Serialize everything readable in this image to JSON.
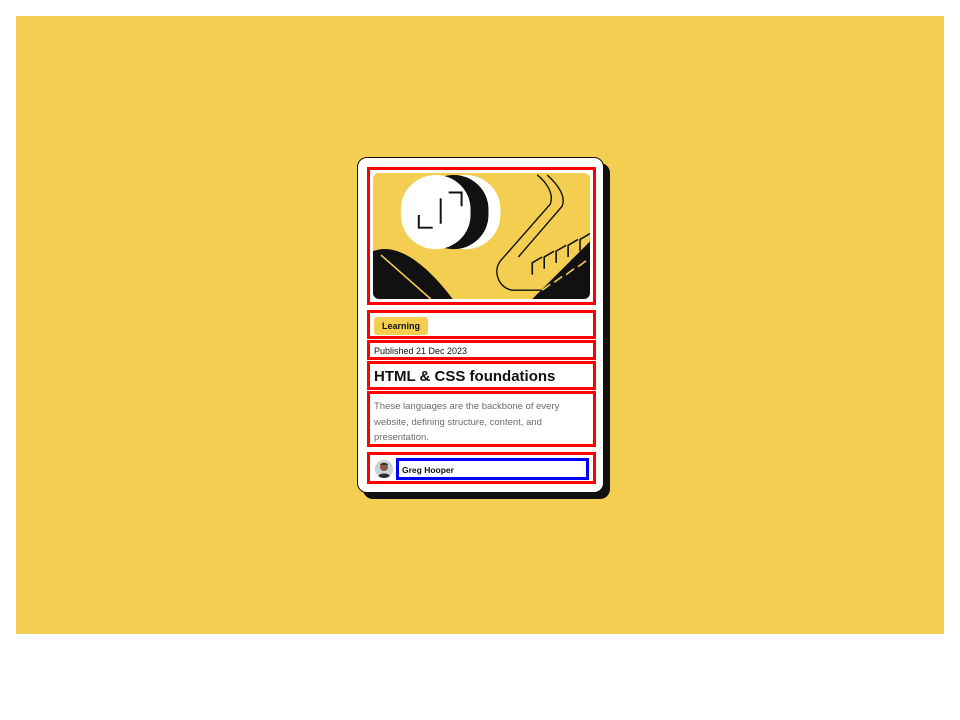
{
  "colors": {
    "background": "#F4CE51",
    "card": "#FFFFFF",
    "ink": "#111111",
    "muted": "#6B6B6B",
    "highlight_red": "#FF0000",
    "highlight_blue": "#0000FF"
  },
  "card": {
    "hero_image": "abstract-illustration",
    "tag": "Learning",
    "published": "Published 21 Dec 2023",
    "title": "HTML & CSS foundations",
    "description": "These languages are the backbone of every website, defining structure, content, and presentation.",
    "author": {
      "name": "Greg Hooper",
      "avatar": "avatar-photo"
    }
  }
}
